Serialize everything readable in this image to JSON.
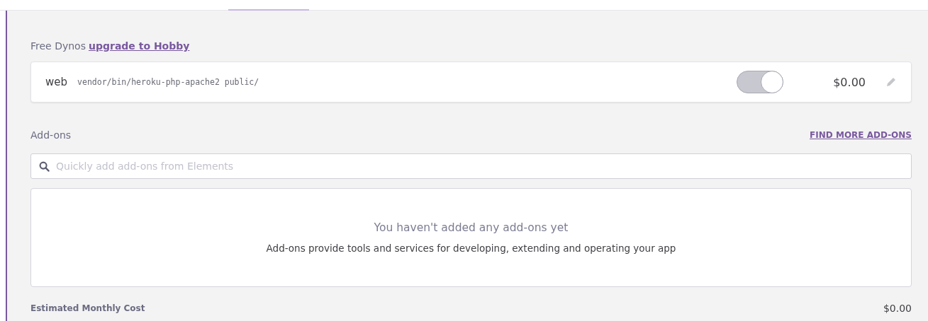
{
  "free_dynos": {
    "label": "Free Dynos",
    "link": "upgrade to Hobby"
  },
  "dynos": [
    {
      "name": "web",
      "command": "vendor/bin/heroku-php-apache2 public/",
      "on": true,
      "price": "$0.00"
    }
  ],
  "addons": {
    "title": "Add-ons",
    "find_more": "FIND MORE ADD-ONS",
    "search_placeholder": "Quickly add add-ons from Elements",
    "empty_title": "You haven't added any add-ons yet",
    "empty_text": "Add-ons provide tools and services for developing, extending and operating your app"
  },
  "estimate": {
    "label": "Estimated Monthly Cost",
    "value": "$0.00"
  }
}
